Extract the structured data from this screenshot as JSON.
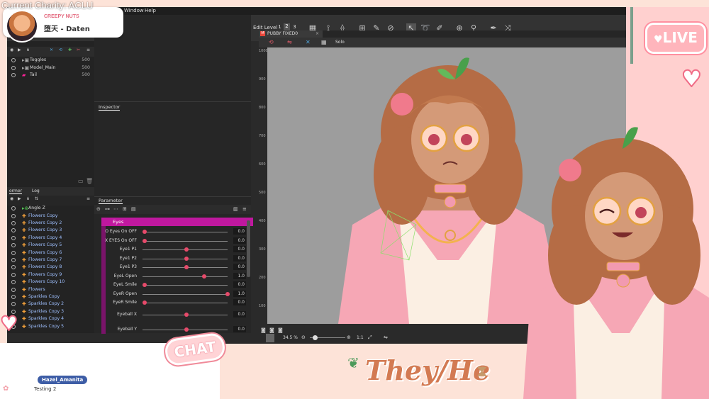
{
  "overlay": {
    "charity_text": "Current Charity: ACLU",
    "live_label": "LIVE",
    "chat_label": "CHAT",
    "pronouns": "They/He"
  },
  "now_playing": {
    "artist": "CREEPY NUTS",
    "song": "堕天 - Daten"
  },
  "chat": {
    "username": "Hazel_Amanita",
    "message": "Testing 2"
  },
  "app": {
    "menu": [
      "Window",
      "Help"
    ],
    "edit_level_label": "Edit Level",
    "edit_levels": [
      "1",
      "2",
      "3"
    ],
    "layers_top": [
      {
        "name": "Toggles",
        "num": "500"
      },
      {
        "name": "Model_Main",
        "num": "500"
      },
      {
        "name": "Tail",
        "num": "500"
      }
    ],
    "deformer_tabs": [
      "ormer",
      "Log"
    ],
    "deformer_root": "Angle Z",
    "deformers": [
      "Flowers Copy",
      "Flowers Copy 2",
      "Flowers Copy 3",
      "Flowers Copy 4",
      "Flowers Copy 5",
      "Flowers Copy 6",
      "Flowers Copy 7",
      "Flowers Copy 8",
      "Flowers Copy 9",
      "Flowers Copy 10",
      "Flowers",
      "Sparkles Copy",
      "Sparkles Copy 2",
      "Sparkles Copy 3",
      "Sparkles Copy 4",
      "Sparkles Copy 5"
    ],
    "inspector_title": "Inspector",
    "parameter_title": "Parameter",
    "param_group": "Eyes",
    "parameters": [
      {
        "name": "O Eyes On OFF",
        "value": "0.0",
        "knob": 0
      },
      {
        "name": "X EYES On OFF",
        "value": "0.0",
        "knob": 0
      },
      {
        "name": "Eye1 P1",
        "value": "0.0",
        "knob": 0.5
      },
      {
        "name": "Eye1 P2",
        "value": "0.0",
        "knob": 0.5
      },
      {
        "name": "Eye1 P3",
        "value": "0.0",
        "knob": 0.5
      },
      {
        "name": "EyeL Open",
        "value": "1.0",
        "knob": 0.72
      },
      {
        "name": "EyeL Smile",
        "value": "0.0",
        "knob": 0
      },
      {
        "name": "EyeR Open",
        "value": "1.0",
        "knob": 1
      },
      {
        "name": "EyeR Smile",
        "value": "0.0",
        "knob": 0
      },
      {
        "name": "Eyeball X",
        "value": "0.0",
        "knob": 0.5
      },
      {
        "name": "Eyeball Y",
        "value": "0.0",
        "knob": 0.5
      }
    ],
    "doc_tab": "PUBBY FIXED0",
    "solo_label": "Solo",
    "ruler_ticks": [
      "1000",
      "900",
      "800",
      "700",
      "600",
      "500",
      "400",
      "300",
      "200",
      "100"
    ],
    "zoom": "34.5",
    "zoom_unit": "%",
    "ratio": "1:1"
  },
  "colors": {
    "accent_pink": "#ffb1b7",
    "param_group_bar": "#c0189f",
    "knob": "#e74a6a",
    "chat_user_badge": "#3d5da6"
  }
}
